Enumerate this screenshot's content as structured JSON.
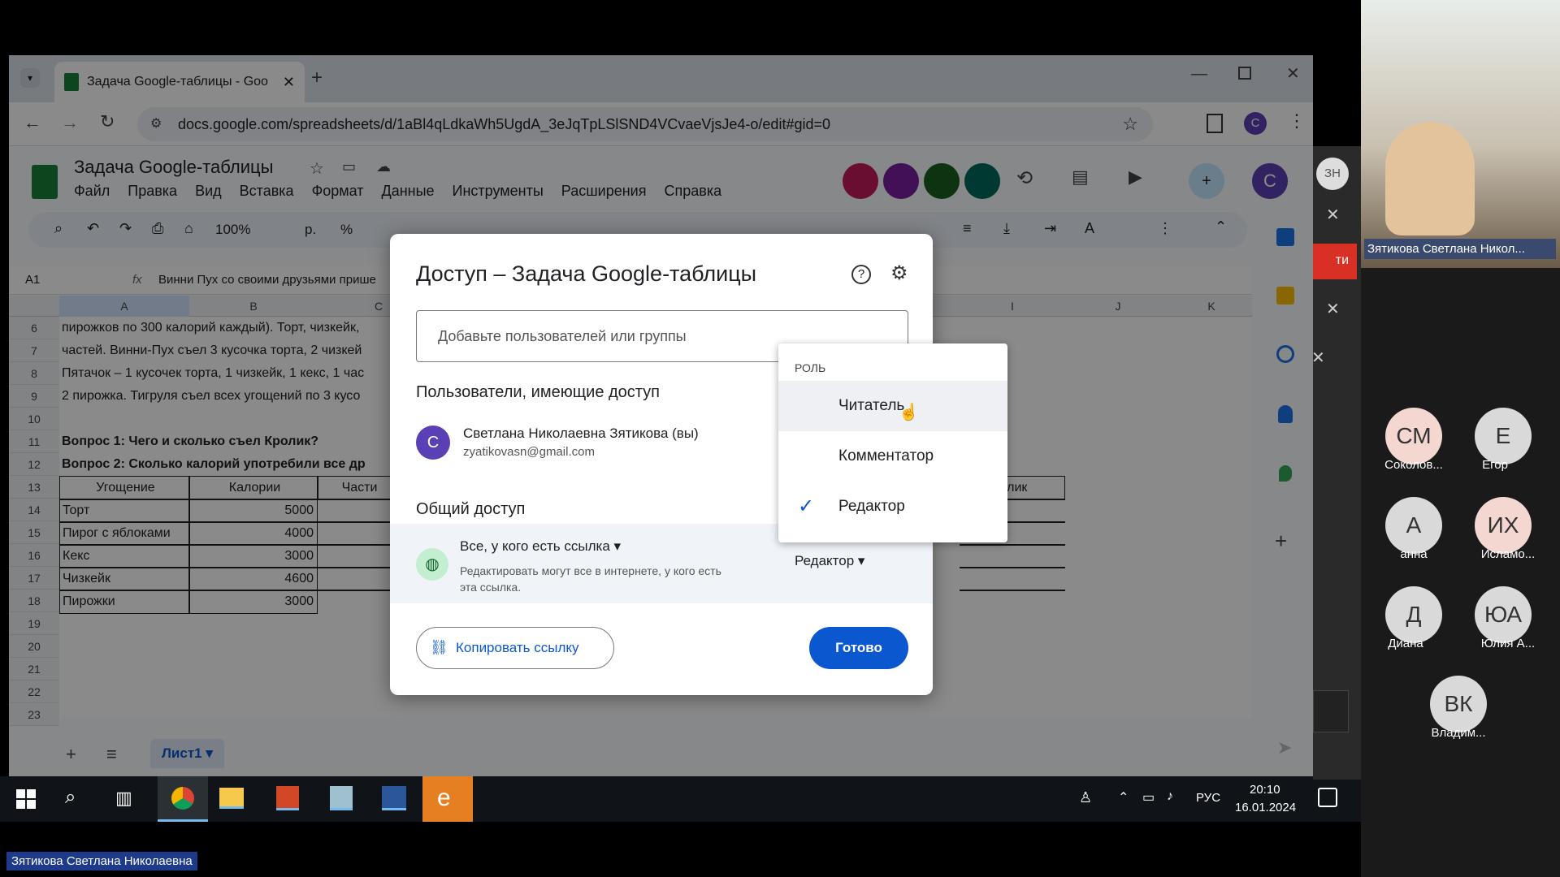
{
  "browser": {
    "tab_title": "Задача Google-таблицы - Goo",
    "url": "docs.google.com/spreadsheets/d/1aBl4qLdkaWh5UgdA_3eJqTpLSlSND4VCvaeVjsJe4-o/edit#gid=0",
    "profile_letter": "C"
  },
  "sheets": {
    "doc_title": "Задача Google-таблицы",
    "menu": [
      "Файл",
      "Правка",
      "Вид",
      "Вставка",
      "Формат",
      "Данные",
      "Инструменты",
      "Расширения",
      "Справка"
    ],
    "zoom": "100%",
    "currency": "р.",
    "percent": "%",
    "cell_ref": "A1",
    "formula": "Винни Пух со своими друзьями прише",
    "user_avatar_letter": "C",
    "col_headers": [
      "A",
      "B",
      "C",
      "I",
      "J",
      "K"
    ],
    "row_numbers": [
      "6",
      "7",
      "8",
      "9",
      "10",
      "11",
      "12",
      "13",
      "14",
      "15",
      "16",
      "17",
      "18",
      "19",
      "20",
      "21",
      "22",
      "23"
    ],
    "text_rows": [
      "пирожков по 300 калорий каждый). Торт, чизкейк,",
      "частей. Винни-Пух съел 3 кусочка торта, 2 чизкей",
      "Пятачок – 1 кусочек торта, 1 чизкейк, 1 кекс, 1 час",
      "2 пирожка. Тигруля съел всех угощений по 3 кусо"
    ],
    "question1": "Вопрос 1: Чего и сколько съел Кролик?",
    "question2": "Вопрос 2: Сколько калорий употребили все др",
    "table_header": [
      "Угощение",
      "Калории",
      "Части"
    ],
    "table_rows": [
      {
        "name": "Торт",
        "cal": "5000"
      },
      {
        "name": "Пирог с яблоками",
        "cal": "4000"
      },
      {
        "name": "Кекс",
        "cal": "3000"
      },
      {
        "name": "Чизкейк",
        "cal": "4600"
      },
      {
        "name": "Пирожки",
        "cal": "3000"
      }
    ],
    "right_header": "олик",
    "sheet_tab": "Лист1"
  },
  "dialog": {
    "title": "Доступ – Задача Google-таблицы",
    "add_placeholder": "Добавьте пользователей или группы",
    "people_heading": "Пользователи, имеющие доступ",
    "user_initial": "C",
    "user_name": "Светлана Николаевна Зятикова (вы)",
    "user_email": "zyatikovasn@gmail.com",
    "general_heading": "Общий доступ",
    "link_scope": "Все, у кого есть ссылка",
    "link_desc_1": "Редактировать могут все в интернете, у кого есть",
    "link_desc_2": "эта ссылка.",
    "link_role": "Редактор",
    "copy_link": "Копировать ссылку",
    "done": "Готово"
  },
  "role_menu": {
    "heading": "РОЛЬ",
    "options": [
      "Читатель",
      "Комментатор",
      "Редактор"
    ],
    "selected": "Редактор",
    "hovered": "Читатель"
  },
  "taskbar": {
    "lang": "РУС",
    "time": "20:10",
    "date": "16.01.2024"
  },
  "conference": {
    "speaker_label": "Зятикова Светлана Никол...",
    "bottom_label": "Зятикова Светлана Николаевна",
    "panel_avatar_letters": "ЗН",
    "panel_button_text": "ти",
    "participants": [
      {
        "initials": "СМ",
        "name": "Соколов..."
      },
      {
        "initials": "Е",
        "name": "Егор"
      },
      {
        "initials": "А",
        "name": "анна"
      },
      {
        "initials": "ИХ",
        "name": "Исламо..."
      },
      {
        "initials": "Д",
        "name": "Диана"
      },
      {
        "initials": "ЮА",
        "name": "Юлия А..."
      },
      {
        "initials": "ВК",
        "name": "Владим..."
      }
    ]
  },
  "colors": {
    "sheets_green": "#188038",
    "accent_blue": "#0b57d0",
    "user_purple": "#5b3fb5"
  }
}
